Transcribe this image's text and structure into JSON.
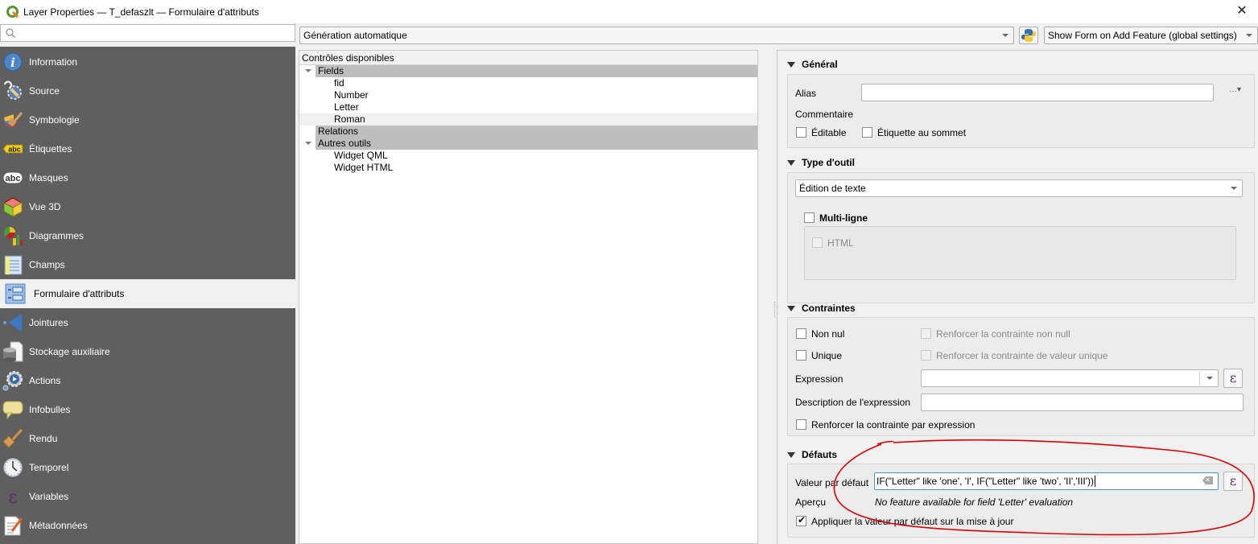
{
  "window": {
    "title": "Layer Properties — T_defaszlt — Formulaire d'attributs",
    "close_icon": "close-icon"
  },
  "sidebar": {
    "search_placeholder": "",
    "items": [
      {
        "label": "Information",
        "icon": "info-icon",
        "active": false
      },
      {
        "label": "Source",
        "icon": "source-settings-icon",
        "active": false
      },
      {
        "label": "Symbologie",
        "icon": "symbology-brush-icon",
        "active": false
      },
      {
        "label": "Étiquettes",
        "icon": "labels-abc-icon",
        "active": false
      },
      {
        "label": "Masques",
        "icon": "masks-abc-icon",
        "active": false
      },
      {
        "label": "Vue 3D",
        "icon": "cube-3d-icon",
        "active": false
      },
      {
        "label": "Diagrammes",
        "icon": "diagram-icon",
        "active": false
      },
      {
        "label": "Champs",
        "icon": "fields-table-icon",
        "active": false
      },
      {
        "label": "Formulaire d'attributs",
        "icon": "attribute-form-icon",
        "active": true
      },
      {
        "label": "Jointures",
        "icon": "joins-icon",
        "active": false
      },
      {
        "label": "Stockage auxiliaire",
        "icon": "auxiliary-storage-icon",
        "active": false
      },
      {
        "label": "Actions",
        "icon": "actions-gear-icon",
        "active": false
      },
      {
        "label": "Infobulles",
        "icon": "tooltip-bubble-icon",
        "active": false
      },
      {
        "label": "Rendu",
        "icon": "rendering-brush-icon",
        "active": false
      },
      {
        "label": "Temporel",
        "icon": "clock-icon",
        "active": false
      },
      {
        "label": "Variables",
        "icon": "epsilon-icon",
        "active": false
      },
      {
        "label": "Métadonnées",
        "icon": "metadata-document-icon",
        "active": false
      }
    ]
  },
  "toolbar": {
    "layout_mode": "Génération automatique",
    "python_icon": "python-icon",
    "form_suppress": "Show Form on Add Feature (global settings)"
  },
  "tree": {
    "header": "Contrôles disponibles",
    "rows": [
      {
        "label": "Fields",
        "type": "group",
        "expanded": true
      },
      {
        "label": "fid",
        "type": "leaf"
      },
      {
        "label": "Number",
        "type": "leaf"
      },
      {
        "label": "Letter",
        "type": "leaf"
      },
      {
        "label": "Roman",
        "type": "leaf",
        "hover": true
      },
      {
        "label": "Relations",
        "type": "group",
        "expanded": false
      },
      {
        "label": "Autres outils",
        "type": "group",
        "expanded": true
      },
      {
        "label": "Widget QML",
        "type": "leaf"
      },
      {
        "label": "Widget HTML",
        "type": "leaf"
      }
    ]
  },
  "general": {
    "title": "Général",
    "alias_label": "Alias",
    "alias_value": "",
    "comment_label": "Commentaire",
    "editable_label": "Éditable",
    "editable_checked": false,
    "label_on_top_label": "Étiquette au sommet",
    "label_on_top_checked": false,
    "more_button": "…"
  },
  "widget_type": {
    "title": "Type d'outil",
    "selected": "Édition de texte",
    "multiline_label": "Multi-ligne",
    "multiline_checked": false,
    "html_label": "HTML",
    "html_checked": false
  },
  "constraints": {
    "title": "Contraintes",
    "not_null_label": "Non nul",
    "not_null_checked": false,
    "enforce_not_null_label": "Renforcer la contrainte non null",
    "unique_label": "Unique",
    "unique_checked": false,
    "enforce_unique_label": "Renforcer la contrainte de valeur unique",
    "expression_label": "Expression",
    "expression_value": "",
    "expression_desc_label": "Description de l'expression",
    "expression_desc_value": "",
    "enforce_expression_label": "Renforcer la contrainte par expression",
    "enforce_expression_checked": false
  },
  "defaults": {
    "title": "Défauts",
    "default_value_label": "Valeur par défaut",
    "default_value": "IF(\"Letter\" like 'one', 'I', IF(\"Letter\" like 'two', 'II','III'))",
    "preview_label": "Aperçu",
    "preview_text": "No feature available for field 'Letter' evaluation",
    "apply_on_update_label": "Appliquer la valeur par défaut sur la mise à jour",
    "apply_on_update_checked": true
  },
  "annotation": {
    "color": "#e00000"
  }
}
